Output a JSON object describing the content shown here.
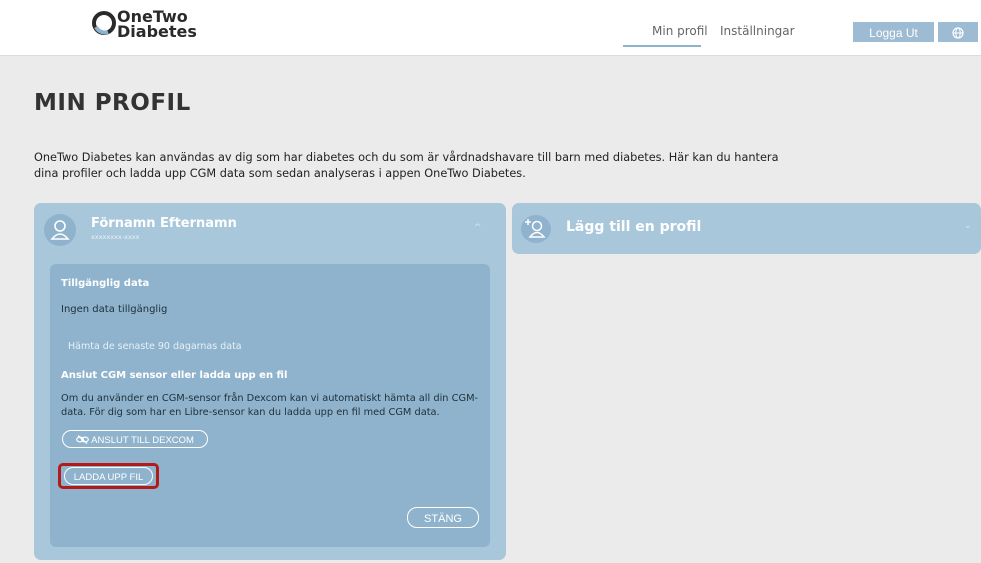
{
  "header": {
    "logo_line1": "OneTwo",
    "logo_line2": "Diabetes",
    "nav": {
      "my_profile": "Min profil",
      "settings": "Inställningar"
    },
    "logout": "Logga Ut",
    "globe_icon": "globe-icon"
  },
  "page": {
    "title": "MIN PROFIL",
    "intro": "OneTwo Diabetes kan användas av dig som har diabetes och du som är vårdnadshavare till barn med diabetes. Här kan du hantera dina profiler och ladda upp CGM data som sedan analyseras i appen OneTwo Diabetes."
  },
  "profile": {
    "name": "Förnamn Efternamn",
    "id": "xxxxxxxx-xxxx",
    "available_title": "Tillgänglig data",
    "available_text": "Ingen data tillgänglig",
    "fetch_link": "Hämta de senaste 90 dagarnas data",
    "cgm_title": "Anslut CGM sensor eller ladda upp en fil",
    "cgm_desc": "Om du använder en CGM-sensor från Dexcom kan vi automatiskt hämta all din CGM-data. För dig som har en Libre-sensor kan du ladda upp en fil med CGM data.",
    "dexcom_button": "ANSLUT TILL DEXCOM",
    "upload_button": "LADDA UPP FIL",
    "close_button": "STÄNG"
  },
  "add_profile": {
    "title": "Lägg till en profil"
  },
  "colors": {
    "background": "#ebebeb",
    "card": "#a9c7db",
    "panel": "#8fb3cc",
    "button": "#9dbcd4",
    "highlight": "#b31b1b"
  }
}
